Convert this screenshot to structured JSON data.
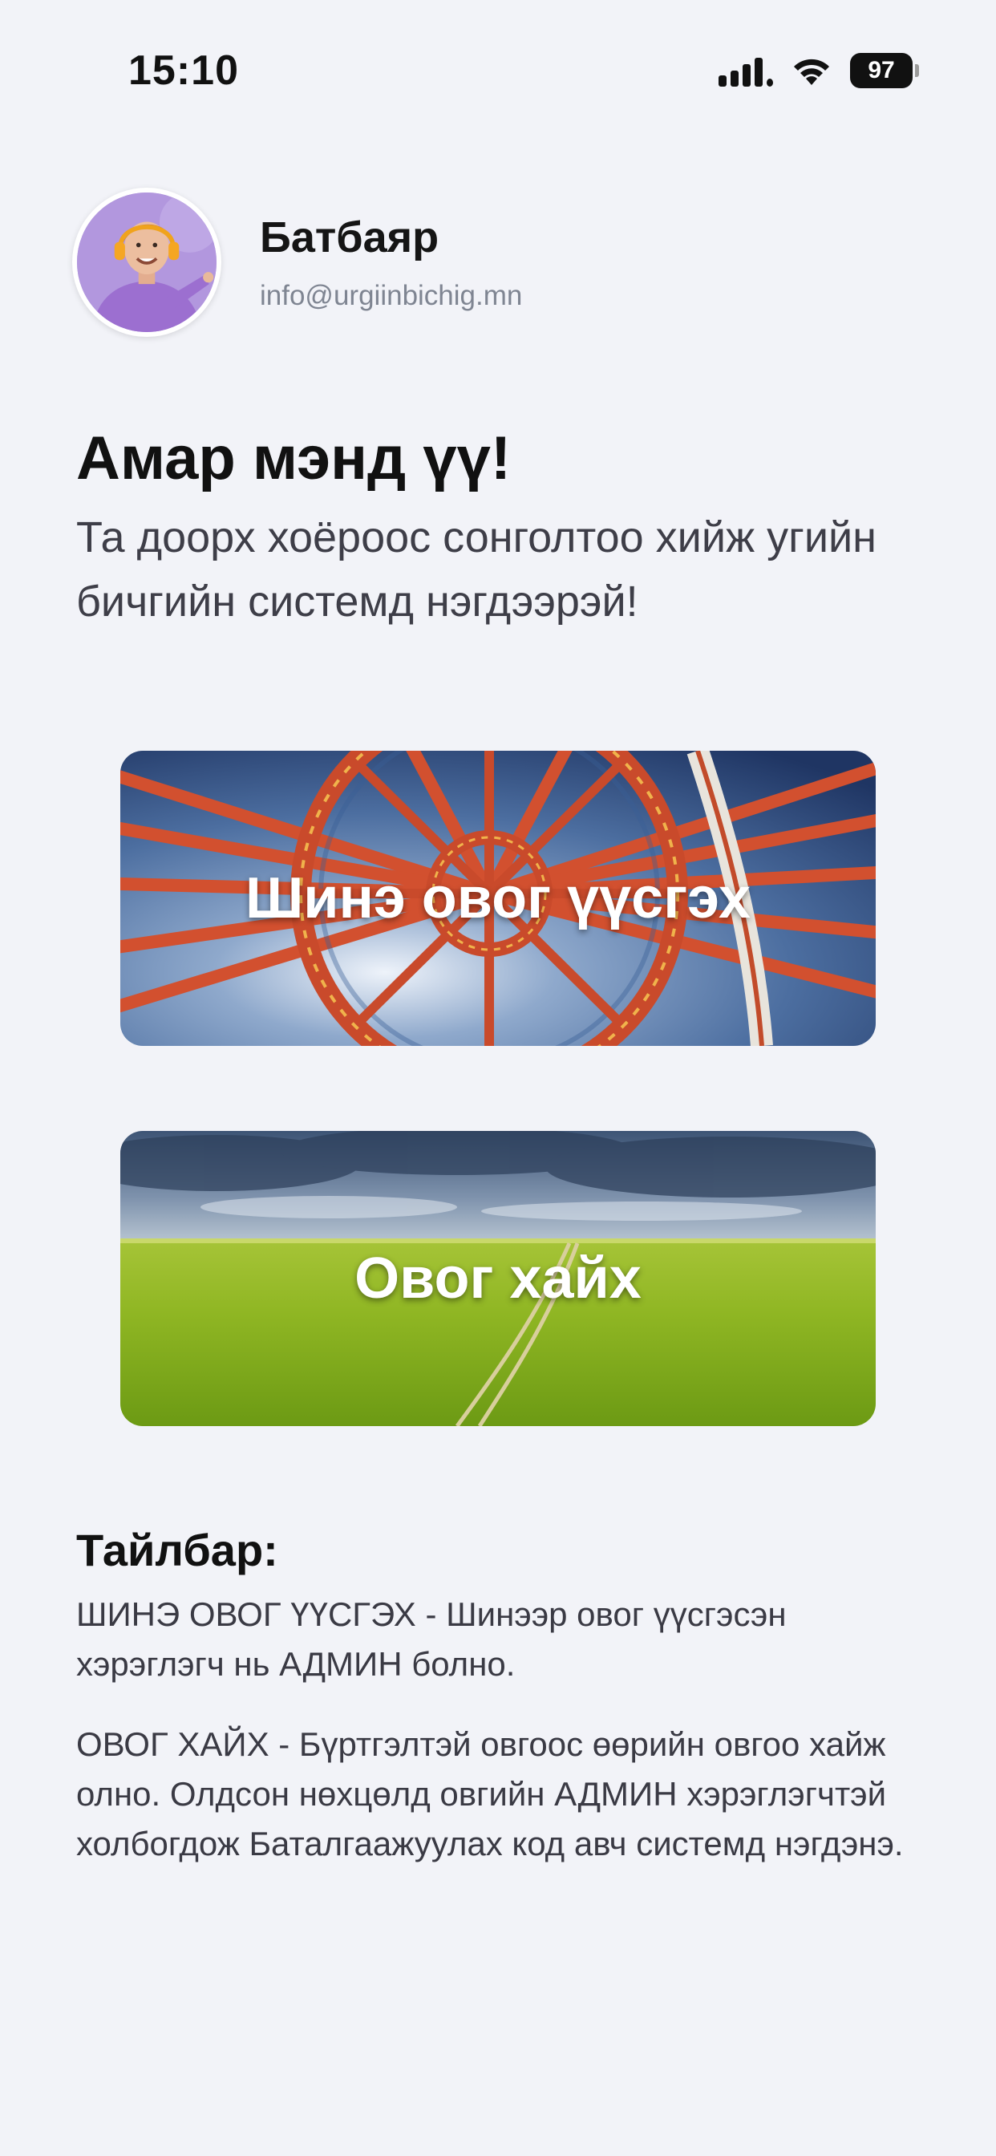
{
  "status_bar": {
    "time": "15:10",
    "battery": "97",
    "icons": [
      "signal-icon",
      "wifi-icon",
      "battery-icon"
    ]
  },
  "profile": {
    "name": "Батбаяр",
    "email": "info@urgiinbichig.mn"
  },
  "greeting": {
    "title": "Амар мэнд үү!",
    "subtitle": "Та доорх хоёроос сонголтоо хийж угийн бичгийн системд нэгдээрэй!"
  },
  "options": {
    "create_clan": {
      "label": "Шинэ овог үүсгэх"
    },
    "search_clan": {
      "label": "Овог хайх"
    }
  },
  "description": {
    "title": "Тайлбар:",
    "paragraphs": [
      "ШИНЭ ОВОГ ҮҮСГЭХ - Шинээр овог үүсгэсэн хэрэглэгч нь АДМИН болно.",
      "ОВОГ ХАЙХ - Бүртгэлтэй овгоос өөрийн овгоо хайж олно. Олдсон нөхцөлд овгийн АДМИН хэрэглэгчтэй холбогдож Баталгаажуулах код авч системд нэгдэнэ."
    ]
  },
  "colors": {
    "background": "#f2f3f8",
    "text_primary": "#111111",
    "text_secondary": "#3e3e48",
    "email_gray": "#7f8592"
  }
}
